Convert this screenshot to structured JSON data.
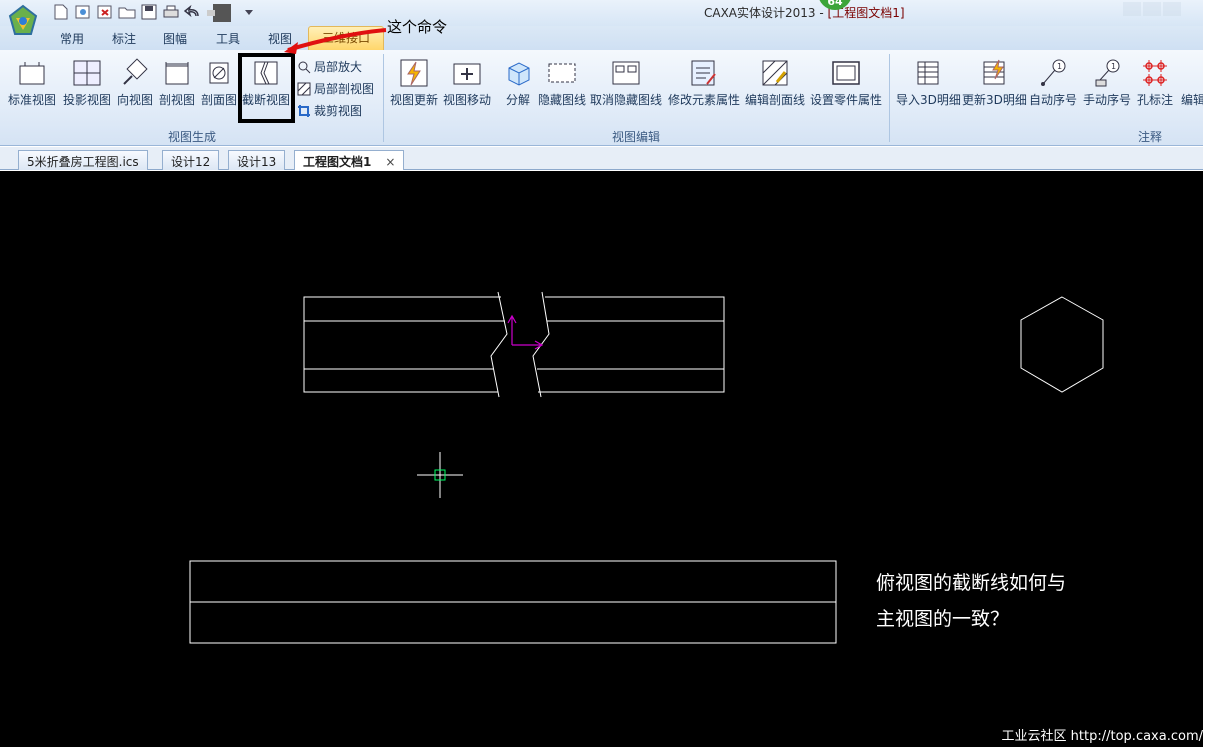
{
  "title_bar": {
    "app_title": "CAXA实体设计2013 - ",
    "doc_title": "[工程图文档1]",
    "badge": "64"
  },
  "qat_icons": [
    "new-icon",
    "open-icon",
    "close-file-icon",
    "folder-icon",
    "save-icon",
    "print-icon",
    "undo-icon",
    "dropdown-icon"
  ],
  "ribbon_tabs": [
    "常用",
    "标注",
    "图幅",
    "工具",
    "视图",
    "三维接口"
  ],
  "ribbon": {
    "view_generation": {
      "label": "视图生成",
      "buttons": [
        "标准视图",
        "投影视图",
        "向视图",
        "剖视图",
        "剖面图",
        "截断视图"
      ],
      "small_buttons": [
        "局部放大",
        "局部剖视图",
        "裁剪视图"
      ]
    },
    "view_edit": {
      "label": "视图编辑",
      "buttons": [
        "视图更新",
        "视图移动",
        "分解",
        "隐藏图线",
        "取消隐藏图线",
        "修改元素属性",
        "编辑剖面线",
        "设置零件属性"
      ]
    },
    "annotation": {
      "label": "注释",
      "buttons": [
        "导入3D明细",
        "更新3D明细",
        "自动序号",
        "手动序号",
        "孔标注",
        "编辑"
      ]
    }
  },
  "annotation_text": "这个命令",
  "doc_tabs": [
    {
      "label": "5米折叠房工程图.ics",
      "active": false
    },
    {
      "label": "设计12",
      "active": false
    },
    {
      "label": "设计13",
      "active": false
    },
    {
      "label": "工程图文档1",
      "active": true
    }
  ],
  "doc_tab_close": "×",
  "canvas": {
    "question_line1": "俯视图的截断线如何与",
    "question_line2": "主视图的一致？",
    "watermark": "工业云社区 http://top.caxa.com/"
  },
  "colors": {
    "canvas_bg": "#000000",
    "line": "#ffffff",
    "axis": "#cc00cc",
    "cursor_box": "#00ff66",
    "active_tab": "#ffd66b"
  }
}
